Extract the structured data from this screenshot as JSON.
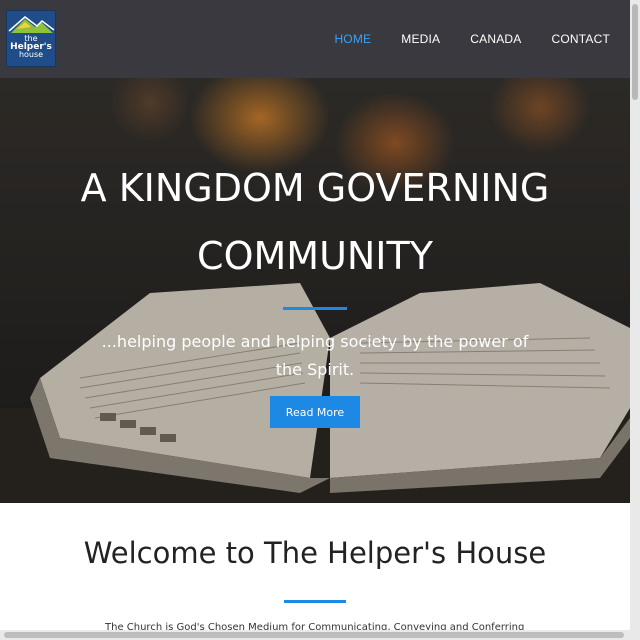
{
  "logo": {
    "line1": "the",
    "line2": "Helper's",
    "line3": "house"
  },
  "nav": {
    "items": [
      {
        "label": "HOME",
        "active": true
      },
      {
        "label": "MEDIA",
        "active": false
      },
      {
        "label": "CANADA",
        "active": false
      },
      {
        "label": "CONTACT",
        "active": false
      }
    ]
  },
  "hero": {
    "title_line1": "A KINGDOM GOVERNING",
    "title_line2": "COMMUNITY",
    "subtitle": "...helping people and helping society by the power of the Spirit.",
    "button_label": "Read More"
  },
  "welcome": {
    "heading": "Welcome to The Helper's House",
    "intro": "The Church is God's Chosen Medium for Communicating, Conveying and Conferring"
  },
  "colors": {
    "accent": "#1e88e5",
    "nav_bg": "#3a393f",
    "active_link": "#3aa3f0"
  }
}
